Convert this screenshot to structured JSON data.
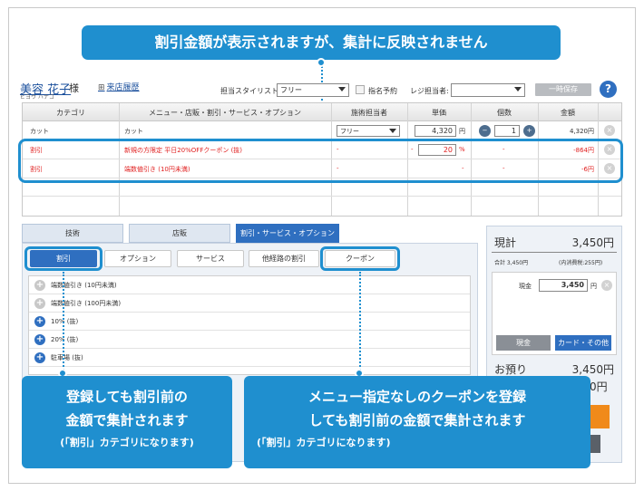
{
  "banner": "割引金額が表示されますが、集計に反映されません",
  "customer": {
    "name": "美容 花子",
    "honorific": "様",
    "kana": "ビヨウ ハナコ",
    "history_link": "来店履歴"
  },
  "toolbar": {
    "stylist_label": "担当スタイリスト:",
    "stylist_value": "フリー",
    "reserve_label": "指名予約",
    "register_label": "レジ担当者:",
    "register_value": "",
    "hold_button": "一時保存",
    "help": "?"
  },
  "table": {
    "headers": [
      "カテゴリ",
      "メニュー・店販・割引・サービス・オプション",
      "施術担当者",
      "単価",
      "個数",
      "金額"
    ],
    "rows": [
      {
        "category": "カット",
        "menu": "カット",
        "staff": "フリー",
        "price": "4,320",
        "unit": "円",
        "qty": "1",
        "amount": "4,320円"
      },
      {
        "category": "割引",
        "menu": "新規の方限定 平日20%OFFクーポン (抜)",
        "staff": "-",
        "price_prefix": "-",
        "price": "20",
        "unit": "%",
        "qty": "-",
        "amount": "-864円"
      },
      {
        "category": "割引",
        "menu": "端数値引き (10円未満)",
        "staff": "-",
        "price": "-",
        "qty": "-",
        "amount": "-6円"
      }
    ]
  },
  "tabs": [
    "技術",
    "店販",
    "割引・サービス・オプション"
  ],
  "subtabs": [
    "割引",
    "オプション",
    "サービス",
    "他経路の割引",
    "クーポン"
  ],
  "list_items": [
    "端数値引き (10円未満)",
    "端数値引き (100円未満)",
    "10% (抜)",
    "20% (抜)",
    "駐車場 (抜)"
  ],
  "summary": {
    "title": "現計",
    "total": "3,450円",
    "subtotal_label": "合計 3,450円",
    "tax_label": "(内消費税:255円)",
    "cash_label": "現金",
    "cash_value": "3,450",
    "cash_unit": "円",
    "btn_cash": "現金",
    "btn_card": "カード・その他",
    "received_label": "お預り",
    "received_value": "3,450円",
    "change_partial": "0円"
  },
  "callouts": {
    "left_line1": "登録しても割引前の",
    "left_line2": "金額で集計されます",
    "left_note": "(「割引」カテゴリになります)",
    "right_line1": "メニュー指定なしのクーポンを登録",
    "right_line2": "しても割引前の金額で集計されます",
    "right_note": "(「割引」カテゴリになります)"
  },
  "colors": {
    "accent": "#1f8fcf",
    "primary": "#2f6fc0",
    "discount": "#e02020"
  }
}
